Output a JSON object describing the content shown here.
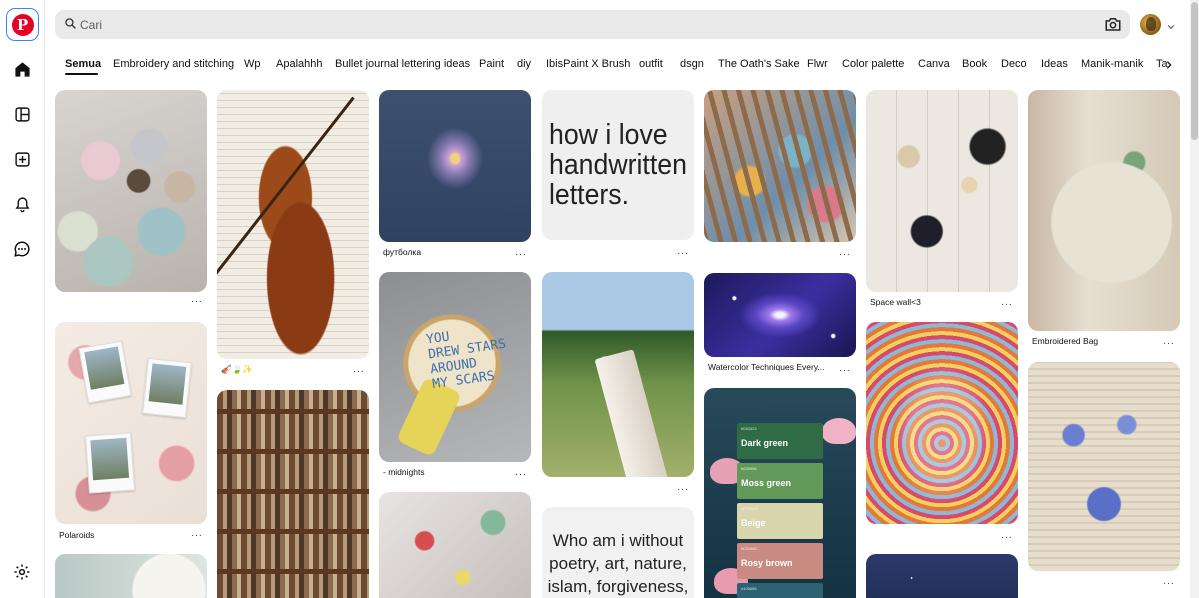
{
  "search": {
    "placeholder": "Cari",
    "value": ""
  },
  "nav_icons": [
    "pinterest-logo",
    "home-icon",
    "dashboard-icon",
    "create-icon",
    "notifications-icon",
    "messages-icon",
    "settings-icon"
  ],
  "tabs": [
    "Semua",
    "Embroidery and stitching",
    "Wp",
    "Apalahhh",
    "Bullet journal lettering ideas",
    "Paint",
    "diy",
    "IbisPaint X Brush",
    "outfit",
    "dsgn",
    "The Oath's Sake",
    "Flwr",
    "Color palette",
    "Canva",
    "Book",
    "Deco",
    "Ideas",
    "Manik-manik",
    "Ta"
  ],
  "active_tab": "Semua",
  "pins": {
    "handwritten_text": [
      "how i love",
      "handwritten",
      "letters."
    ],
    "hoop_text": [
      "YOU",
      "DREW STARS",
      "AROUND",
      "MY SCARS"
    ],
    "quote_text": [
      "Who am i without",
      "poetry, art, nature,",
      "islam, forgiveness,"
    ],
    "palette": [
      {
        "hex": "#043323",
        "name": "Dark green",
        "color": "#2f6b45"
      },
      {
        "hex": "#639958",
        "name": "Moss green",
        "color": "#639958"
      },
      {
        "hex": "#F7F4D5",
        "name": "Beige",
        "color": "#d9d5ad"
      },
      {
        "hex": "#D3968C",
        "name": "Rosy brown",
        "color": "#c98a82"
      },
      {
        "hex": "#105666",
        "name": "",
        "color": "#2c6272"
      }
    ],
    "captions": {
      "shirt": "футболка",
      "violin": "🎻🍃✨",
      "space": "Space wall<3",
      "bag": "Embroidered Bag",
      "galaxy": "Watercolor Techniques Every...",
      "hoop": "- midnights",
      "polaroids": "Polaroids"
    },
    "more_label": "···"
  },
  "colors": {
    "brand": "#e60023",
    "search_bg": "#e9e9e9"
  }
}
